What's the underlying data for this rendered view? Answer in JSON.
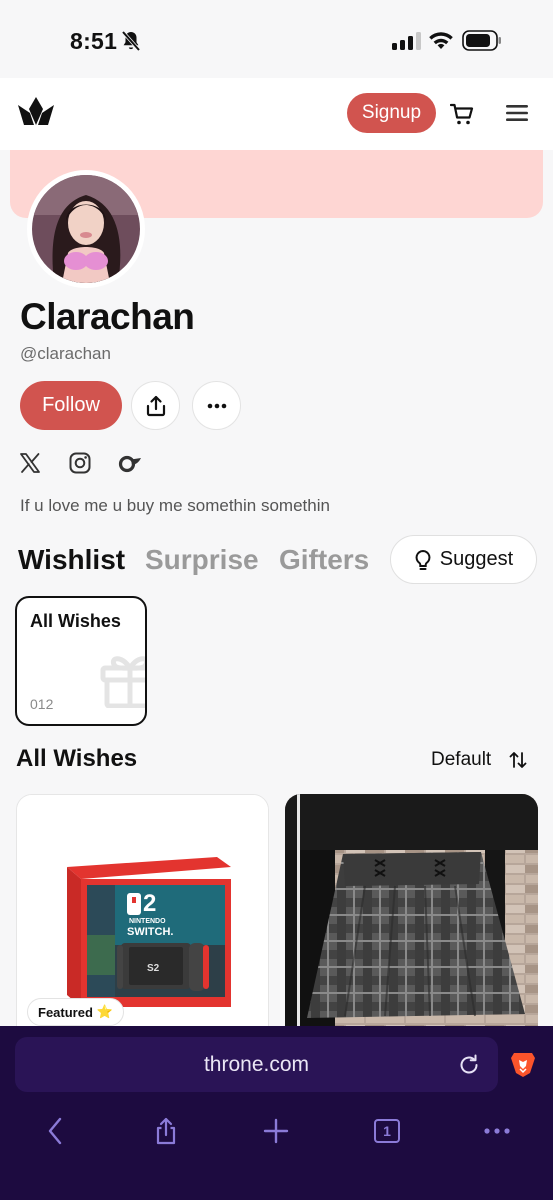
{
  "status_bar": {
    "time": "8:51"
  },
  "header": {
    "signup_label": "Signup"
  },
  "profile": {
    "name": "Clarachan",
    "handle": "@clarachan",
    "follow_label": "Follow",
    "bio": "If u love me u buy me somethin somethin"
  },
  "tabs": [
    {
      "label": "Wishlist",
      "active": true
    },
    {
      "label": "Surprise",
      "active": false
    },
    {
      "label": "Gifters",
      "active": false
    }
  ],
  "suggest_label": "Suggest",
  "collection": {
    "title": "All Wishes",
    "count": "012"
  },
  "wishes": {
    "title": "All Wishes",
    "sort_label": "Default",
    "items": [
      {
        "image": "nintendo-switch-box",
        "badge": "Featured",
        "badge_icon": "⭐"
      },
      {
        "image": "plaid-skirt"
      }
    ]
  },
  "browser": {
    "url": "throne.com",
    "tab_count": "1"
  },
  "colors": {
    "accent": "#d1544f",
    "banner": "#fed6d3",
    "browser_bg": "#1d0b40",
    "browser_icon": "#8b7bd8"
  }
}
